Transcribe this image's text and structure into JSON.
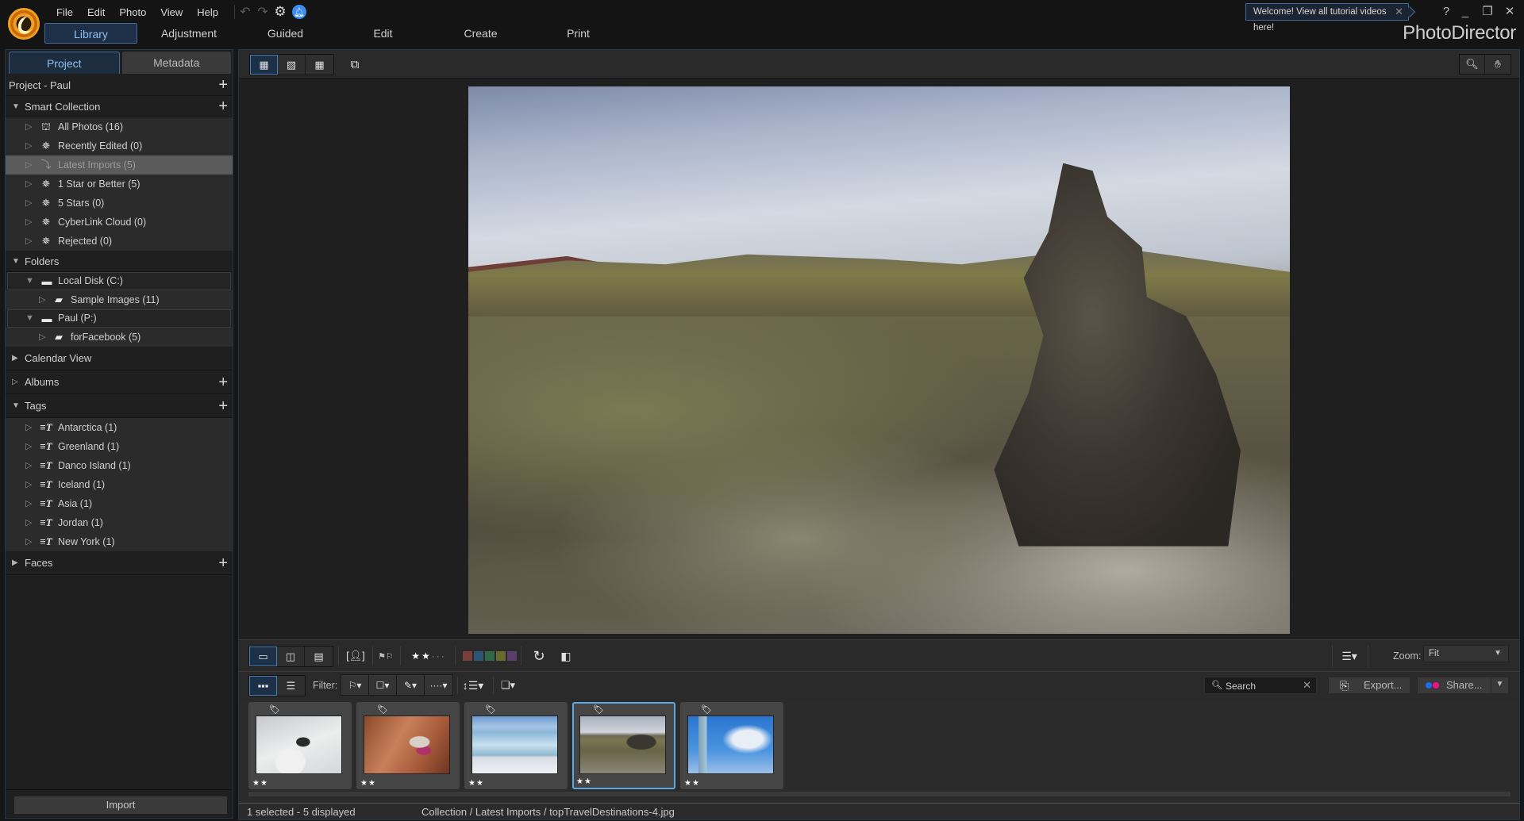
{
  "app": {
    "brand": "PhotoDirector",
    "menu": [
      "File",
      "Edit",
      "Photo",
      "View",
      "Help"
    ],
    "quick_access": {
      "undo_icon": "undo-icon",
      "redo_icon": "redo-icon",
      "settings_icon": "gear-icon",
      "notification_icon": "bell-icon"
    },
    "welcome_tip": "Welcome! View all tutorial videos here!",
    "window_controls": {
      "help": "?",
      "minimize": "_",
      "restore": "❐",
      "close": "✕"
    }
  },
  "mode_tabs": [
    {
      "label": "Library",
      "active": true
    },
    {
      "label": "Adjustment",
      "active": false
    },
    {
      "label": "Guided",
      "active": false
    },
    {
      "label": "Edit",
      "active": false
    },
    {
      "label": "Create",
      "active": false
    },
    {
      "label": "Print",
      "active": false
    }
  ],
  "left_panel": {
    "tabs": [
      {
        "label": "Project",
        "active": true
      },
      {
        "label": "Metadata",
        "active": false
      }
    ],
    "project_title": "Project - Paul",
    "smart_collection": {
      "title": "Smart Collection",
      "items": [
        {
          "label": "All Photos (16)",
          "icon": "all-photos-icon",
          "selected": false
        },
        {
          "label": "Recently Edited (0)",
          "icon": "smart-wand-icon",
          "selected": false
        },
        {
          "label": "Latest Imports (5)",
          "icon": "import-icon",
          "selected": true
        },
        {
          "label": "1 Star or Better (5)",
          "icon": "smart-wand-icon",
          "selected": false
        },
        {
          "label": "5 Stars (0)",
          "icon": "smart-wand-icon",
          "selected": false
        },
        {
          "label": "CyberLink Cloud (0)",
          "icon": "smart-wand-icon",
          "selected": false
        },
        {
          "label": "Rejected (0)",
          "icon": "smart-wand-icon",
          "selected": false
        }
      ]
    },
    "folders": {
      "title": "Folders",
      "drives": [
        {
          "label": "Local Disk (C:)",
          "children": [
            {
              "label": "Sample Images (11)"
            }
          ]
        },
        {
          "label": "Paul (P:)",
          "children": [
            {
              "label": "forFacebook (5)"
            }
          ]
        }
      ]
    },
    "calendar_view": "Calendar View",
    "albums": "Albums",
    "tags": {
      "title": "Tags",
      "items": [
        "Antarctica (1)",
        "Greenland (1)",
        "Danco Island (1)",
        "Iceland (1)",
        "Asia (1)",
        "Jordan (1)",
        "New York (1)"
      ]
    },
    "faces": "Faces",
    "import_label": "Import"
  },
  "viewer": {
    "view_modes": [
      "viewer-with-filmstrip-icon",
      "viewer-icon",
      "grid-icon"
    ],
    "active_view_mode": 0,
    "compare_icon": "swap-display-icon",
    "zoom_tools": [
      "magnifier-icon",
      "hand-icon"
    ],
    "photo_description": "Iceland lava field with moss-covered rocks and a tall rock formation, mountains under a cloudy sky"
  },
  "toolbar1": {
    "layout_modes": [
      "single-view-icon",
      "compare-view-icon",
      "multi-view-icon"
    ],
    "face_tag_icon": "face-tag-icon",
    "flags": [
      "flag-pick-icon",
      "flag-reject-icon"
    ],
    "rating": {
      "stars": 2,
      "max": 5
    },
    "color_labels": [
      "#7a4038",
      "#2e5478",
      "#2f6a44",
      "#6a6a2c",
      "#5a3e6e"
    ],
    "rotate_icon": "rotate-icon",
    "flip_icon": "flip-icon",
    "sort_icon": "sort-menu-icon",
    "zoom_label": "Zoom:",
    "zoom_value": "Fit"
  },
  "toolbar2": {
    "display_modes": [
      "filmstrip-icon",
      "list-icon"
    ],
    "filter_label": "Filter:",
    "filters": [
      "flag-filter-icon",
      "label-filter-icon",
      "edit-filter-icon",
      "more-filter-icon"
    ],
    "sort_order_icon": "sort-order-icon",
    "stack_icon": "stack-icon",
    "search_placeholder": "Search",
    "export_label": "Export...",
    "share_label": "Share..."
  },
  "filmstrip": {
    "thumbnails": [
      {
        "subject": "penguin",
        "stars": "★★",
        "selected": false
      },
      {
        "subject": "camel",
        "stars": "★★",
        "selected": false
      },
      {
        "subject": "glacier",
        "stars": "★★",
        "selected": false
      },
      {
        "subject": "iceland-rock",
        "stars": "★★",
        "selected": true
      },
      {
        "subject": "skyscraper",
        "stars": "★★",
        "selected": false
      }
    ]
  },
  "status": {
    "selection": "1 selected - 5 displayed",
    "path": "Collection / Latest Imports / topTravelDestinations-4.jpg"
  }
}
